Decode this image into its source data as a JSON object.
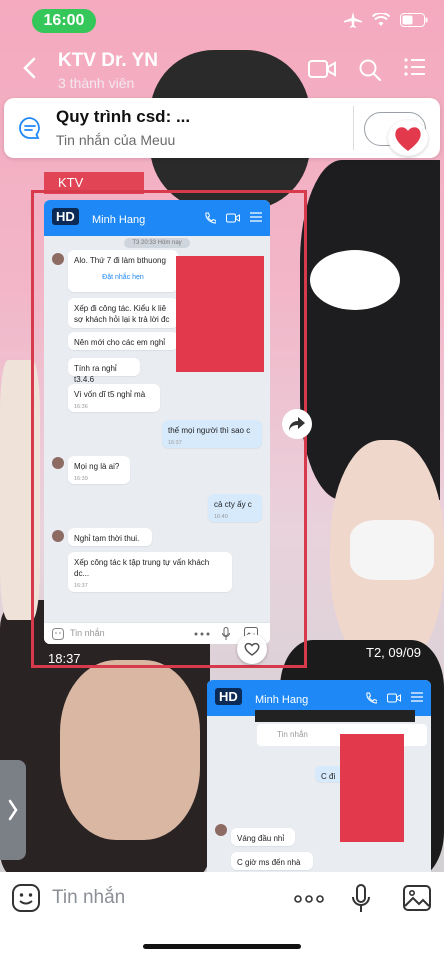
{
  "status_bar": {
    "time": "16:00"
  },
  "header": {
    "title": "KTV Dr. YN",
    "subtitle": "3 thành viên"
  },
  "pinned": {
    "title": "Quy trình csd: ...",
    "subtitle": "Tin nhắn của Meuu"
  },
  "tag": {
    "label": "KTV"
  },
  "inner_chat": {
    "badge": "HD",
    "contact_name": "Minh Hang",
    "date_label": "T3 20:33 Hôm nay",
    "messages": [
      {
        "text": "Alo. Thứ 7 đi làm bthuong",
        "time": ""
      },
      {
        "text": "Đặt nhắc hẹn",
        "time": ""
      },
      {
        "text": "Xếp đi công tác. Kiểu k liê sợ khách hỏi lại k trả lời đc",
        "time": ""
      },
      {
        "text": "Nên mới cho các em nghỉ",
        "time": ""
      },
      {
        "text": "Tính ra nghỉ t3.4.6",
        "time": ""
      },
      {
        "text": "Vì vốn dĩ t5 nghỉ mà",
        "time": "16:36"
      },
      {
        "text": "thế mọi người thì sao c",
        "time": "16:37"
      },
      {
        "text": "Mọi ng là ai?",
        "time": "16:39"
      },
      {
        "text": "cả cty ấy c",
        "time": "16:40"
      },
      {
        "text": "Nghỉ tạm thời thui.",
        "time": ""
      },
      {
        "text": "Xếp công tác k tập trung tự vấn khách dc...",
        "time": "16:37"
      }
    ],
    "input_placeholder": "Tin nhắn"
  },
  "overlay_times": {
    "left": "18:37",
    "right": "T2, 09/09"
  },
  "inner_chat_2": {
    "badge": "HD",
    "contact_name": "Minh Hang",
    "input_placeholder": "Tin nhắn",
    "messages": [
      {
        "text": "C đi"
      },
      {
        "text": "Váng đầu nhỉ"
      },
      {
        "text": "C giờ ms đến nhà"
      }
    ]
  },
  "composer": {
    "placeholder": "Tin nhắn"
  },
  "icons": [
    "airplane-icon",
    "wifi-icon",
    "battery-icon",
    "back-icon",
    "video-call-icon",
    "search-icon",
    "menu-icon",
    "chat-bubble-icon",
    "heart-icon",
    "share-icon",
    "emoji-icon",
    "more-icon",
    "mic-icon",
    "image-icon"
  ],
  "colors": {
    "time_pill": "#35c759",
    "heart": "#e23a4c",
    "messenger_blue": "#1e88f6",
    "redaction": "#e23a4c"
  }
}
